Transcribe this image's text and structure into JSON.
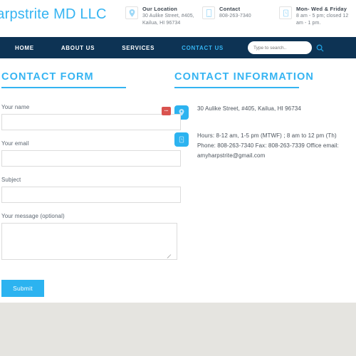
{
  "header": {
    "logo": "Amy B Harpstrite MD LLC",
    "info_blocks": [
      {
        "icon": "map-pin-icon",
        "title": "Our Location",
        "desc": "30 Aulike Street, #405, Kailua, HI 96734"
      },
      {
        "icon": "phone-icon",
        "title": "Contact",
        "desc": "808-263-7340"
      },
      {
        "icon": "clock-icon",
        "title": "Mon- Wed & Friday",
        "desc": "8 am - 5 pm; closed 12 am - 1 pm."
      }
    ]
  },
  "nav": {
    "items": [
      {
        "label": "HOME",
        "active": false
      },
      {
        "label": "ABOUT US",
        "active": false
      },
      {
        "label": "SERVICES",
        "active": false
      },
      {
        "label": "CONTACT US",
        "active": true
      }
    ],
    "search": {
      "placeholder": "Type to search..",
      "value": "",
      "icon": "search-icon"
    }
  },
  "contact_form": {
    "title": "CONTACT FORM",
    "fields": [
      {
        "label": "Your name",
        "value": "",
        "type": "text",
        "error": true
      },
      {
        "label": "Your email",
        "value": "",
        "type": "text",
        "error": false
      },
      {
        "label": "Subject",
        "value": "",
        "type": "text",
        "error": false
      },
      {
        "label": "Your message (optional)",
        "value": "",
        "type": "textarea",
        "error": false
      }
    ],
    "error_badge_text": "···",
    "submit_label": "Submit"
  },
  "contact_information": {
    "title": "CONTACT INFORMATION",
    "rows": [
      {
        "icon": "map-pin-icon",
        "text": "30 Aulike Street, #405, Kailua, HI 96734"
      },
      {
        "icon": "clock-icon",
        "text": "Hours: 8-12 am, 1-5 pm (MTWF) ; 8 am to 12 pm (Th) Phone: 808-263-7340 Fax: 808-263-7339 Office email: amyharpstrite@gmail.com"
      }
    ]
  },
  "colors": {
    "accent": "#2cb3f0",
    "navy": "#0d3354",
    "error": "#d9534f",
    "footer": "#e5e4e0"
  }
}
